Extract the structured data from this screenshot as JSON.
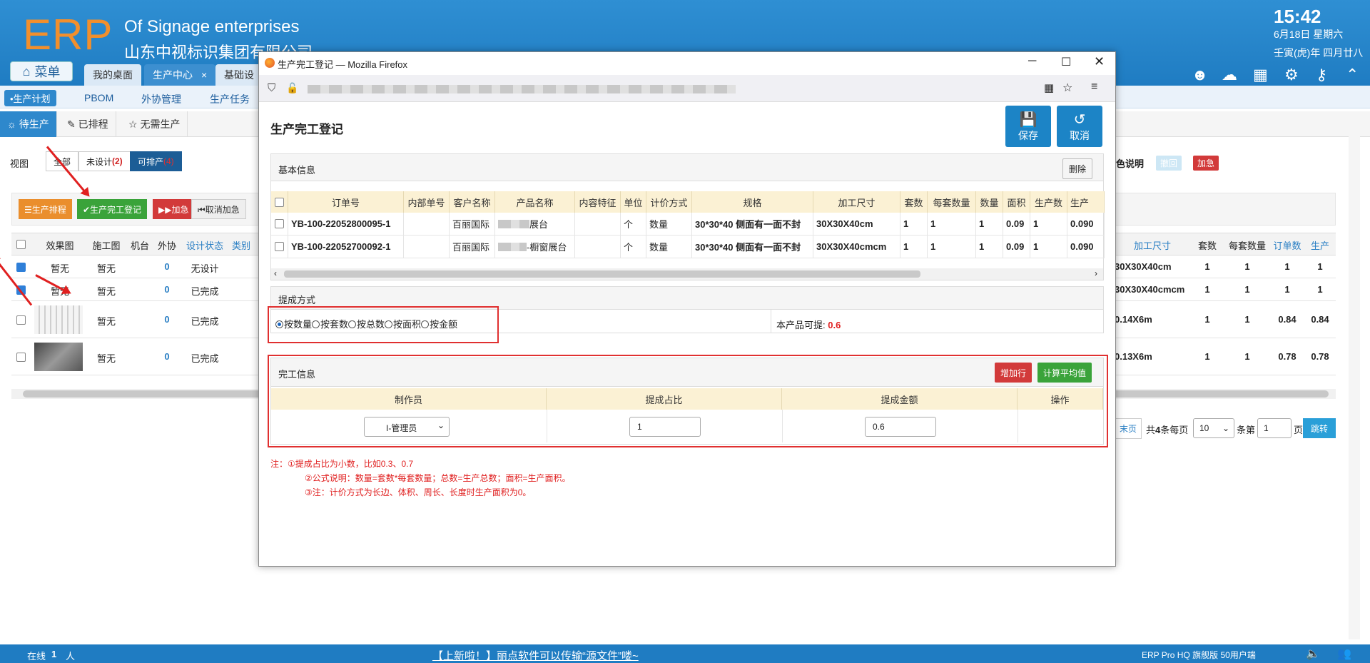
{
  "header": {
    "logo": "ERP",
    "enterprise_en": "Of Signage enterprises",
    "enterprise_cn": "山东中视标识集团有限公司",
    "time": "15:42",
    "date": "6月18日 星期六",
    "lunar": "壬寅(虎)年 四月廿八",
    "menu_label": "菜单",
    "tabs": [
      "我的桌面",
      "生产中心",
      "基础设"
    ],
    "tab_close": "×"
  },
  "subnav": {
    "items": [
      "•生产计划",
      "PBOM",
      "外协管理",
      "生产任务"
    ]
  },
  "state_tabs": [
    "待生产",
    "已排程",
    "无需生产"
  ],
  "view": {
    "label": "视图",
    "buttons": [
      "全部",
      "未设计",
      "可排产"
    ],
    "undesigned_count": "(2)",
    "schedulable_count": "(4)"
  },
  "actions": [
    "☰生产排程",
    "✔生产完工登记",
    "▶▶加急",
    "⏮取消加急"
  ],
  "bg_table": {
    "headers": [
      "效果图",
      "施工图",
      "机台",
      "外协",
      "设计状态",
      "类别"
    ],
    "rows": [
      {
        "effect": "暂无",
        "construct": "暂无",
        "outsource": "0",
        "status": "无设计"
      },
      {
        "effect": "暂无",
        "construct": "暂无",
        "outsource": "0",
        "status": "已完成"
      },
      {
        "effect": "",
        "construct": "暂无",
        "outsource": "0",
        "status": "已完成"
      },
      {
        "effect": "",
        "construct": "暂无",
        "outsource": "0",
        "status": "已完成"
      }
    ],
    "right_headers": [
      "加工尺寸",
      "套数",
      "每套数量",
      "订单数",
      "生产"
    ],
    "right_rows": [
      {
        "size": "30X30X40cm",
        "sets": "1",
        "per": "1",
        "order": "1",
        "prod": "1"
      },
      {
        "size": "30X30X40cmcm",
        "sets": "1",
        "per": "1",
        "order": "1",
        "prod": "1"
      },
      {
        "size": "0.14X6m",
        "sets": "1",
        "per": "1",
        "order": "0.84",
        "prod": "0.84"
      },
      {
        "size": "0.13X6m",
        "sets": "1",
        "per": "1",
        "order": "0.78",
        "prod": "0.78"
      }
    ],
    "legend_label": "色说明",
    "legend_badge1": "撤回",
    "legend_badge2": "加急"
  },
  "pagination": {
    "last": "末页",
    "total_prefix": "共",
    "total": "4",
    "total_suffix": "条每页",
    "page_size": "10",
    "page_label": "条第",
    "page": "1",
    "page_suffix": "页",
    "go": "跳转"
  },
  "popup": {
    "window_title": "生产完工登记 — Mozilla Firefox",
    "page_title": "生产完工登记",
    "save": "保存",
    "cancel": "取消",
    "basic_info": "基本信息",
    "delete": "删除",
    "table_headers": [
      "订单号",
      "内部单号",
      "客户名称",
      "产品名称",
      "内容特征",
      "单位",
      "计价方式",
      "规格",
      "加工尺寸",
      "套数",
      "每套数量",
      "数量",
      "面积",
      "生产数",
      "生产"
    ],
    "rows": [
      {
        "order": "YB-100-22052800095-1",
        "inner": "",
        "customer": "百丽国际",
        "product": "展台",
        "feature": "",
        "unit": "个",
        "pricing": "数量",
        "spec": "30*30*40 侧面有一面不封",
        "size": "30X30X40cm",
        "sets": "1",
        "per": "1",
        "qty": "1",
        "area": "0.09",
        "prod": "1",
        "prod2": "0.090"
      },
      {
        "order": "YB-100-22052700092-1",
        "inner": "",
        "customer": "百丽国际",
        "product": "-橱窗展台",
        "feature": "",
        "unit": "个",
        "pricing": "数量",
        "spec": "30*30*40 侧面有一面不封",
        "size": "30X30X40cmcm",
        "sets": "1",
        "per": "1",
        "qty": "1",
        "area": "0.09",
        "prod": "1",
        "prod2": "0.090"
      }
    ],
    "commission_title": "提成方式",
    "commission_options": [
      "按数量",
      "按套数",
      "按总数",
      "按面积",
      "按金额"
    ],
    "can_commission_label": "本产品可提:",
    "can_commission_value": "0.6",
    "completion_title": "完工信息",
    "add_row": "增加行",
    "calc_avg": "计算平均值",
    "completion_headers": [
      "制作员",
      "提成占比",
      "提成金额",
      "操作"
    ],
    "maker": "I-管理员",
    "ratio": "1",
    "amount": "0.6",
    "notes": [
      "注：①提成占比为小数，比如0.3、0.7",
      "②公式说明：数量=套数*每套数量；总数=生产总数；面积=生产面积。",
      "③注：计价方式为长边、体积、周长、长度时生产面积为0。"
    ]
  },
  "footer": {
    "online_label": "在线",
    "online_count": "1",
    "online_suffix": "人",
    "marquee": "【上新啦！】丽点软件可以传输“源文件”喽~",
    "edition": "ERP Pro HQ 旗舰版 50用户端"
  },
  "colors": {
    "header_blue": "#1f7cc2",
    "save_blue": "#1c84c6",
    "alert_red": "#e02020"
  }
}
